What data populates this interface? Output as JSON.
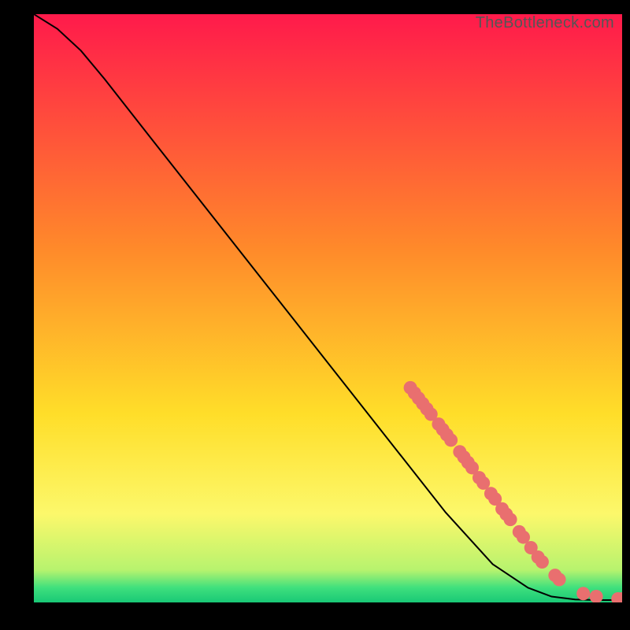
{
  "watermark": "TheBottleneck.com",
  "chart_data": {
    "type": "line",
    "title": "",
    "xlabel": "",
    "ylabel": "",
    "xlim": [
      0,
      100
    ],
    "ylim": [
      0,
      100
    ],
    "background_gradient": {
      "stops": [
        {
          "offset": 0.0,
          "color": "#ff1a4b"
        },
        {
          "offset": 0.4,
          "color": "#ff8a2a"
        },
        {
          "offset": 0.68,
          "color": "#ffde29"
        },
        {
          "offset": 0.85,
          "color": "#fcf86b"
        },
        {
          "offset": 0.945,
          "color": "#b7f36e"
        },
        {
          "offset": 0.975,
          "color": "#3fe07d"
        },
        {
          "offset": 1.0,
          "color": "#19c876"
        }
      ]
    },
    "curve": [
      {
        "x": 0,
        "y": 100.0
      },
      {
        "x": 4,
        "y": 97.5
      },
      {
        "x": 8,
        "y": 93.8
      },
      {
        "x": 12,
        "y": 89.0
      },
      {
        "x": 20,
        "y": 78.8
      },
      {
        "x": 30,
        "y": 66.1
      },
      {
        "x": 40,
        "y": 53.4
      },
      {
        "x": 50,
        "y": 40.7
      },
      {
        "x": 60,
        "y": 28.0
      },
      {
        "x": 70,
        "y": 15.3
      },
      {
        "x": 78,
        "y": 6.5
      },
      {
        "x": 84,
        "y": 2.5
      },
      {
        "x": 88,
        "y": 1.0
      },
      {
        "x": 92,
        "y": 0.5
      },
      {
        "x": 96,
        "y": 0.4
      },
      {
        "x": 100,
        "y": 0.4
      }
    ],
    "markers": [
      {
        "x": 64.0,
        "y": 36.5
      },
      {
        "x": 64.7,
        "y": 35.6
      },
      {
        "x": 65.4,
        "y": 34.7
      },
      {
        "x": 66.1,
        "y": 33.8
      },
      {
        "x": 66.8,
        "y": 32.9
      },
      {
        "x": 67.5,
        "y": 32.0
      },
      {
        "x": 68.8,
        "y": 30.3
      },
      {
        "x": 69.5,
        "y": 29.4
      },
      {
        "x": 70.2,
        "y": 28.5
      },
      {
        "x": 70.9,
        "y": 27.6
      },
      {
        "x": 72.4,
        "y": 25.6
      },
      {
        "x": 73.1,
        "y": 24.7
      },
      {
        "x": 73.8,
        "y": 23.8
      },
      {
        "x": 74.5,
        "y": 22.9
      },
      {
        "x": 75.7,
        "y": 21.2
      },
      {
        "x": 76.4,
        "y": 20.3
      },
      {
        "x": 77.7,
        "y": 18.5
      },
      {
        "x": 78.4,
        "y": 17.6
      },
      {
        "x": 79.6,
        "y": 15.9
      },
      {
        "x": 80.3,
        "y": 15.0
      },
      {
        "x": 81.0,
        "y": 14.1
      },
      {
        "x": 82.5,
        "y": 12.0
      },
      {
        "x": 83.2,
        "y": 11.1
      },
      {
        "x": 84.5,
        "y": 9.3
      },
      {
        "x": 85.7,
        "y": 7.7
      },
      {
        "x": 86.4,
        "y": 6.9
      },
      {
        "x": 88.6,
        "y": 4.6
      },
      {
        "x": 89.3,
        "y": 3.9
      },
      {
        "x": 93.4,
        "y": 1.5
      },
      {
        "x": 95.6,
        "y": 1.0
      },
      {
        "x": 99.3,
        "y": 0.6
      },
      {
        "x": 100.0,
        "y": 0.6
      }
    ],
    "marker_color": "#e96f6f",
    "curve_color": "#000000"
  }
}
